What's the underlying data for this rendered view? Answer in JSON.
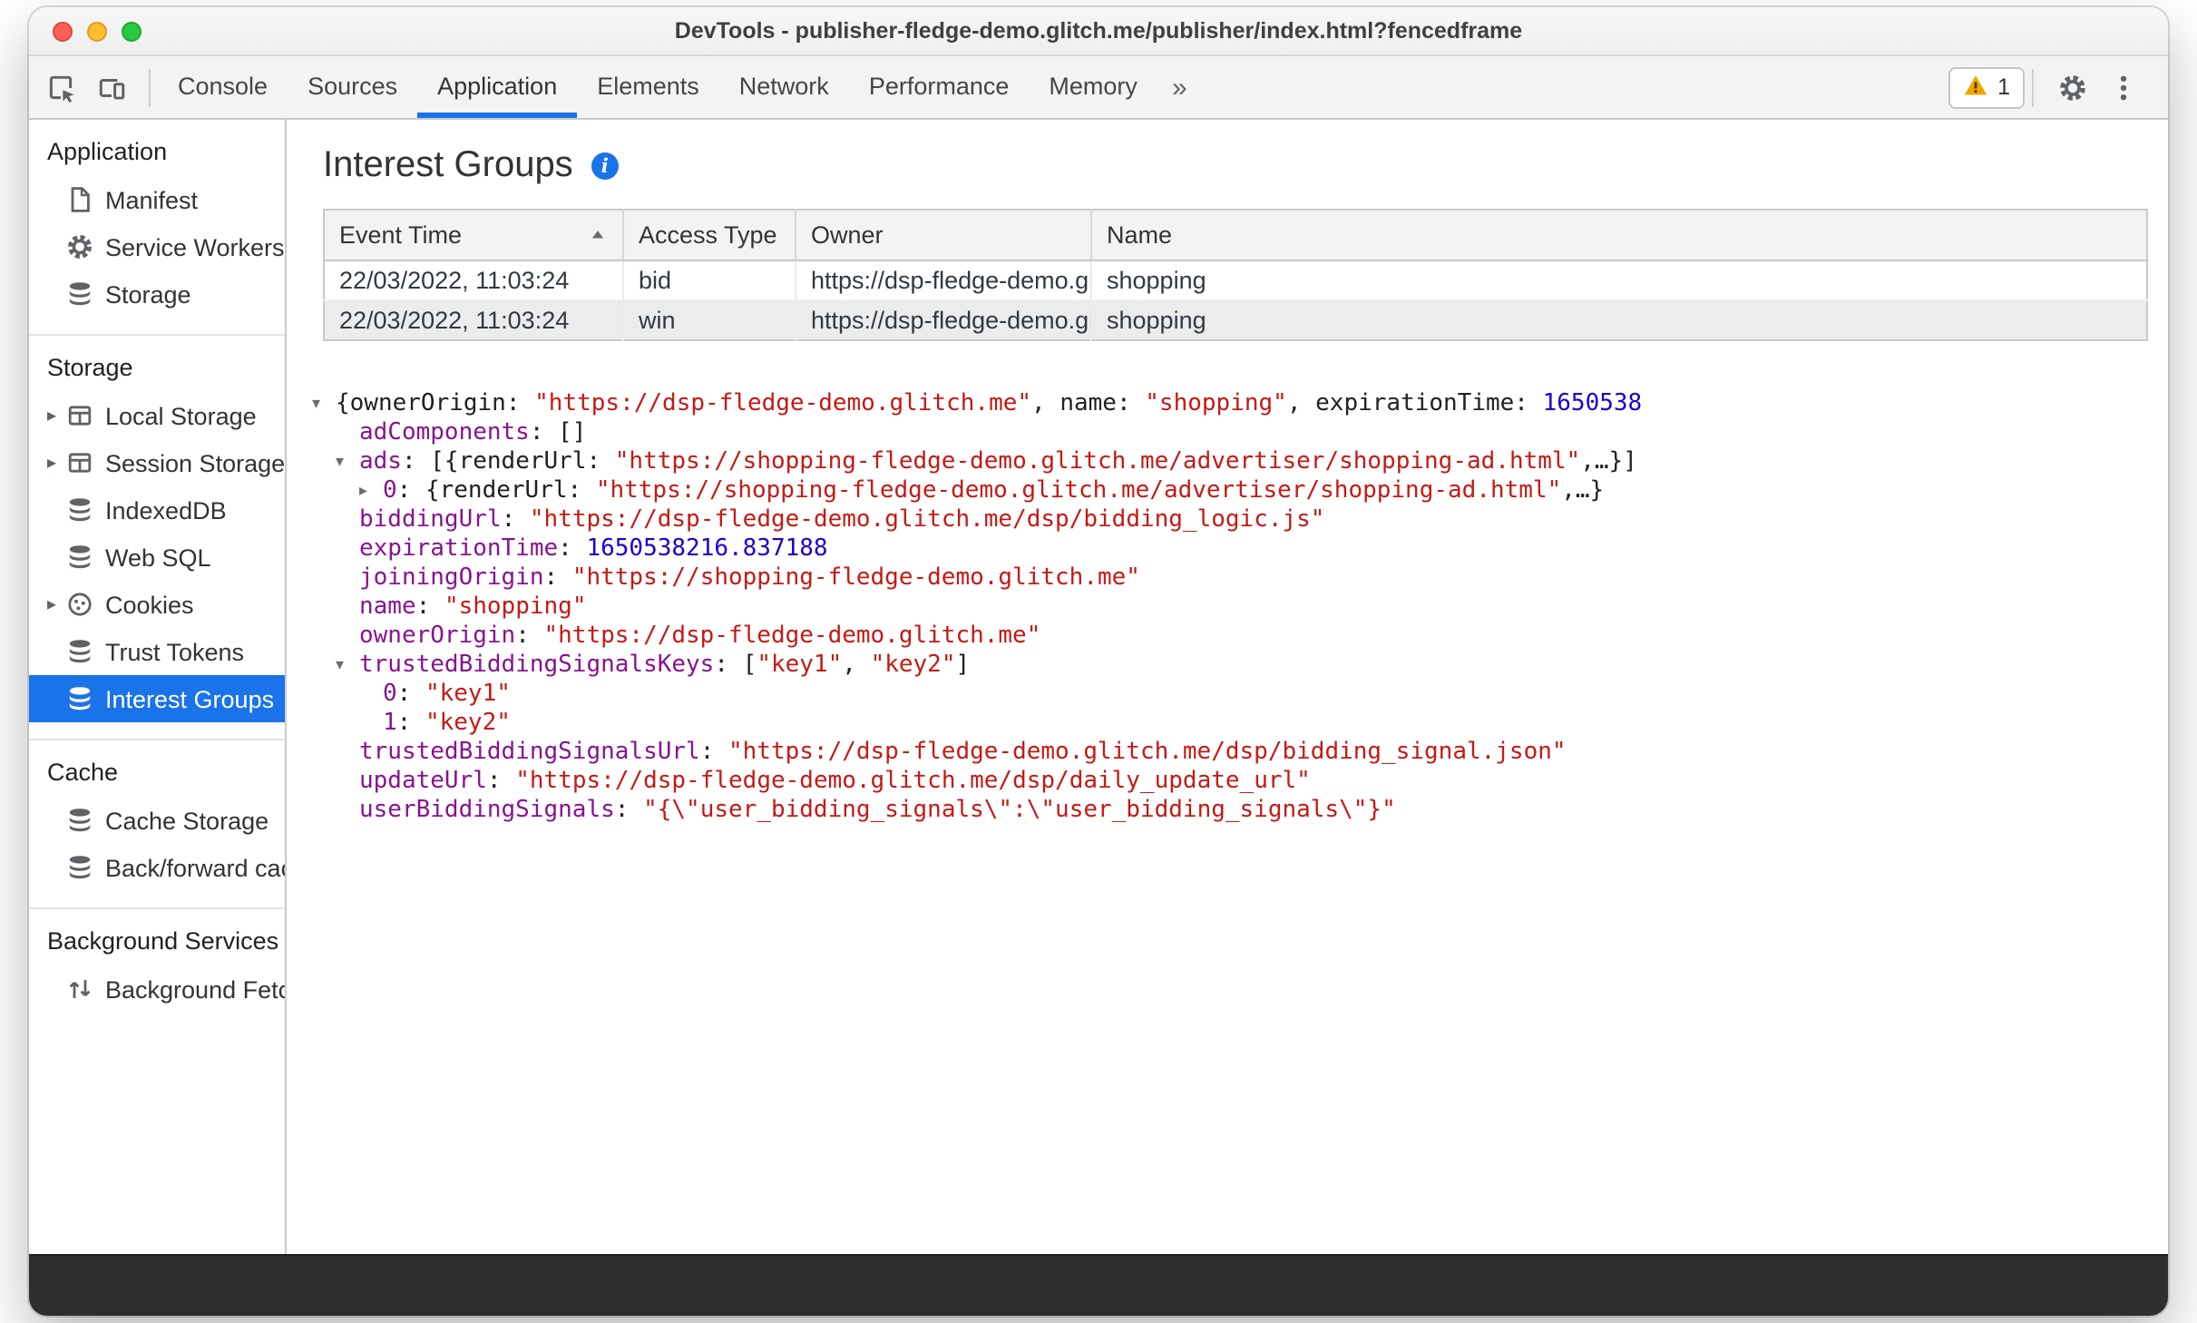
{
  "window": {
    "title": "DevTools - publisher-fledge-demo.glitch.me/publisher/index.html?fencedframe"
  },
  "toolbar": {
    "left_icons": [
      "inspect-icon",
      "device-toolbar-icon"
    ],
    "tabs": [
      {
        "label": "Console",
        "active": false
      },
      {
        "label": "Sources",
        "active": false
      },
      {
        "label": "Application",
        "active": true
      },
      {
        "label": "Elements",
        "active": false
      },
      {
        "label": "Network",
        "active": false
      },
      {
        "label": "Performance",
        "active": false
      },
      {
        "label": "Memory",
        "active": false
      }
    ],
    "overflow_label": "»",
    "warning_badge": {
      "count": "1",
      "icon": "warning-icon"
    },
    "right_icons": [
      "gear-icon",
      "menu-dots-icon"
    ]
  },
  "sidebar": {
    "sections": [
      {
        "title": "Application",
        "items": [
          {
            "label": "Manifest",
            "icon": "document-icon"
          },
          {
            "label": "Service Workers",
            "icon": "gear-icon"
          },
          {
            "label": "Storage",
            "icon": "database-icon"
          }
        ]
      },
      {
        "title": "Storage",
        "items": [
          {
            "label": "Local Storage",
            "icon": "table-icon",
            "expandable": true
          },
          {
            "label": "Session Storage",
            "icon": "table-icon",
            "expandable": true
          },
          {
            "label": "IndexedDB",
            "icon": "database-icon"
          },
          {
            "label": "Web SQL",
            "icon": "database-icon"
          },
          {
            "label": "Cookies",
            "icon": "cookie-icon",
            "expandable": true
          },
          {
            "label": "Trust Tokens",
            "icon": "database-icon"
          },
          {
            "label": "Interest Groups",
            "icon": "database-icon",
            "selected": true
          }
        ]
      },
      {
        "title": "Cache",
        "items": [
          {
            "label": "Cache Storage",
            "icon": "database-icon"
          },
          {
            "label": "Back/forward cache",
            "icon": "database-icon"
          }
        ]
      },
      {
        "title": "Background Services",
        "items": [
          {
            "label": "Background Fetch",
            "icon": "up-down-arrows-icon"
          }
        ]
      }
    ]
  },
  "main": {
    "title": "Interest Groups",
    "info_icon": "info-icon",
    "table": {
      "columns": [
        {
          "label": "Event Time",
          "sorted": "asc"
        },
        {
          "label": "Access Type"
        },
        {
          "label": "Owner"
        },
        {
          "label": "Name"
        }
      ],
      "rows": [
        {
          "cells": [
            "22/03/2022, 11:03:24",
            "bid",
            "https://dsp-fledge-demo.gl…",
            "shopping"
          ],
          "selected": false
        },
        {
          "cells": [
            "22/03/2022, 11:03:24",
            "win",
            "https://dsp-fledge-demo.gl…",
            "shopping"
          ],
          "selected": true
        }
      ]
    },
    "tree": {
      "lines": [
        {
          "level": 0,
          "expander": "open",
          "tokens": [
            {
              "c": "p",
              "t": "{ownerOrigin: "
            },
            {
              "c": "s",
              "t": "\"https://dsp-fledge-demo.glitch.me\""
            },
            {
              "c": "p",
              "t": ", name: "
            },
            {
              "c": "s",
              "t": "\"shopping\""
            },
            {
              "c": "p",
              "t": ", expirationTime: "
            },
            {
              "c": "n",
              "t": "1650538"
            }
          ]
        },
        {
          "level": 1,
          "expander": null,
          "tokens": [
            {
              "c": "k",
              "t": "adComponents"
            },
            {
              "c": "p",
              "t": ": []"
            }
          ]
        },
        {
          "level": 1,
          "expander": "open",
          "tokens": [
            {
              "c": "k",
              "t": "ads"
            },
            {
              "c": "p",
              "t": ": [{renderUrl: "
            },
            {
              "c": "s",
              "t": "\"https://shopping-fledge-demo.glitch.me/advertiser/shopping-ad.html\""
            },
            {
              "c": "p",
              "t": ",…}]"
            }
          ]
        },
        {
          "level": 2,
          "expander": "closed",
          "tokens": [
            {
              "c": "k",
              "t": "0"
            },
            {
              "c": "p",
              "t": ": {renderUrl: "
            },
            {
              "c": "s",
              "t": "\"https://shopping-fledge-demo.glitch.me/advertiser/shopping-ad.html\""
            },
            {
              "c": "p",
              "t": ",…}"
            }
          ]
        },
        {
          "level": 1,
          "expander": null,
          "tokens": [
            {
              "c": "k",
              "t": "biddingUrl"
            },
            {
              "c": "p",
              "t": ": "
            },
            {
              "c": "s",
              "t": "\"https://dsp-fledge-demo.glitch.me/dsp/bidding_logic.js\""
            }
          ]
        },
        {
          "level": 1,
          "expander": null,
          "tokens": [
            {
              "c": "k",
              "t": "expirationTime"
            },
            {
              "c": "p",
              "t": ": "
            },
            {
              "c": "n",
              "t": "1650538216.837188"
            }
          ]
        },
        {
          "level": 1,
          "expander": null,
          "tokens": [
            {
              "c": "k",
              "t": "joiningOrigin"
            },
            {
              "c": "p",
              "t": ": "
            },
            {
              "c": "s",
              "t": "\"https://shopping-fledge-demo.glitch.me\""
            }
          ]
        },
        {
          "level": 1,
          "expander": null,
          "tokens": [
            {
              "c": "k",
              "t": "name"
            },
            {
              "c": "p",
              "t": ": "
            },
            {
              "c": "s",
              "t": "\"shopping\""
            }
          ]
        },
        {
          "level": 1,
          "expander": null,
          "tokens": [
            {
              "c": "k",
              "t": "ownerOrigin"
            },
            {
              "c": "p",
              "t": ": "
            },
            {
              "c": "s",
              "t": "\"https://dsp-fledge-demo.glitch.me\""
            }
          ]
        },
        {
          "level": 1,
          "expander": "open",
          "tokens": [
            {
              "c": "k",
              "t": "trustedBiddingSignalsKeys"
            },
            {
              "c": "p",
              "t": ": ["
            },
            {
              "c": "s",
              "t": "\"key1\""
            },
            {
              "c": "p",
              "t": ", "
            },
            {
              "c": "s",
              "t": "\"key2\""
            },
            {
              "c": "p",
              "t": "]"
            }
          ]
        },
        {
          "level": 2,
          "expander": null,
          "tokens": [
            {
              "c": "k",
              "t": "0"
            },
            {
              "c": "p",
              "t": ": "
            },
            {
              "c": "s",
              "t": "\"key1\""
            }
          ]
        },
        {
          "level": 2,
          "expander": null,
          "tokens": [
            {
              "c": "k",
              "t": "1"
            },
            {
              "c": "p",
              "t": ": "
            },
            {
              "c": "s",
              "t": "\"key2\""
            }
          ]
        },
        {
          "level": 1,
          "expander": null,
          "tokens": [
            {
              "c": "k",
              "t": "trustedBiddingSignalsUrl"
            },
            {
              "c": "p",
              "t": ": "
            },
            {
              "c": "s",
              "t": "\"https://dsp-fledge-demo.glitch.me/dsp/bidding_signal.json\""
            }
          ]
        },
        {
          "level": 1,
          "expander": null,
          "tokens": [
            {
              "c": "k",
              "t": "updateUrl"
            },
            {
              "c": "p",
              "t": ": "
            },
            {
              "c": "s",
              "t": "\"https://dsp-fledge-demo.glitch.me/dsp/daily_update_url\""
            }
          ]
        },
        {
          "level": 1,
          "expander": null,
          "tokens": [
            {
              "c": "k",
              "t": "userBiddingSignals"
            },
            {
              "c": "p",
              "t": ": "
            },
            {
              "c": "s",
              "t": "\"{\\\"user_bidding_signals\\\":\\\"user_bidding_signals\\\"}\""
            }
          ]
        }
      ]
    }
  },
  "colors": {
    "accent": "#1a73e8",
    "selection": "#1a73e8",
    "warning": "#f2a600",
    "token_property": "#881391",
    "token_string": "#c41a16",
    "token_number": "#1c00cf"
  }
}
